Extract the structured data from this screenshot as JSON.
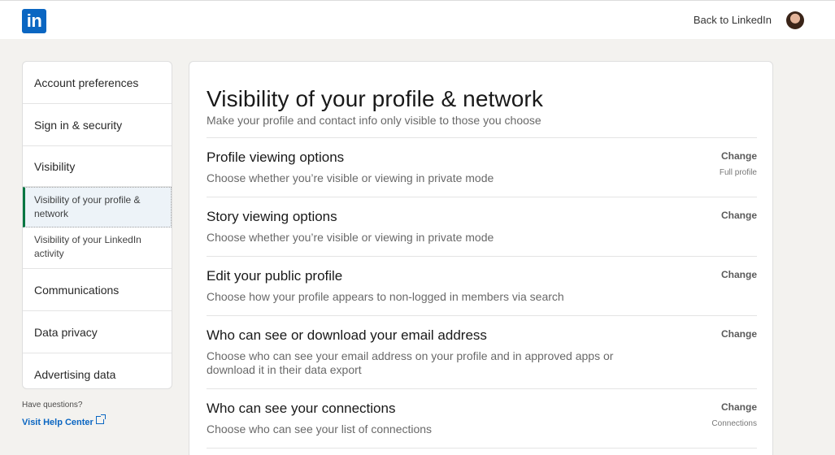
{
  "header": {
    "logo_text": "in",
    "back_label": "Back to LinkedIn",
    "brand_color": "#0a66c2"
  },
  "sidebar": {
    "items": [
      {
        "label": "Account preferences"
      },
      {
        "label": "Sign in & security"
      },
      {
        "label": "Visibility"
      }
    ],
    "sub_items": [
      {
        "label": "Visibility of your profile & network",
        "active": true
      },
      {
        "label": "Visibility of your LinkedIn activity",
        "active": false
      }
    ],
    "items_after": [
      {
        "label": "Communications"
      },
      {
        "label": "Data privacy"
      },
      {
        "label": "Advertising data"
      }
    ],
    "help_text": "Have questions?",
    "help_link": "Visit Help Center"
  },
  "main": {
    "title": "Visibility of your profile & network",
    "subtitle": "Make your profile and contact info only visible to those you choose",
    "rows": [
      {
        "title": "Profile viewing options",
        "desc": "Choose whether you’re visible or viewing in private mode",
        "action": "Change",
        "value": "Full profile"
      },
      {
        "title": "Story viewing options",
        "desc": "Choose whether you’re visible or viewing in private mode",
        "action": "Change",
        "value": ""
      },
      {
        "title": "Edit your public profile",
        "desc": "Choose how your profile appears to non-logged in members via search",
        "action": "Change",
        "value": ""
      },
      {
        "title": "Who can see or download your email address",
        "desc": "Choose who can see your email address on your profile and in approved apps or download it in their data export",
        "action": "Change",
        "value": ""
      },
      {
        "title": "Who can see your connections",
        "desc": "Choose who can see your list of connections",
        "action": "Change",
        "value": "Connections"
      }
    ]
  }
}
